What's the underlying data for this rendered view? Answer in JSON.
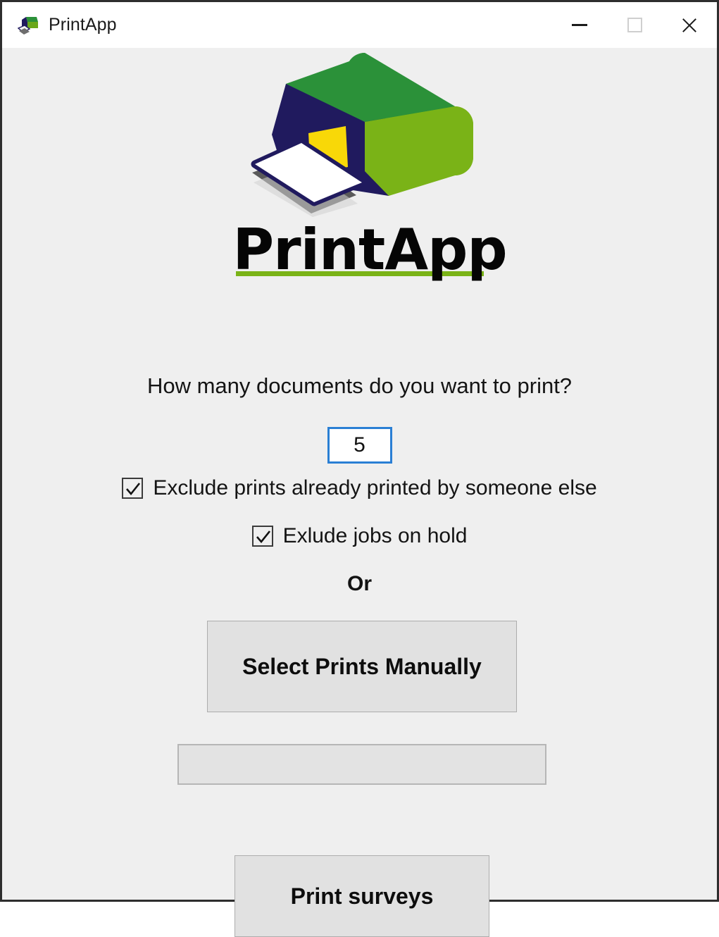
{
  "window": {
    "title": "PrintApp",
    "icon": "printer-app-icon",
    "controls": {
      "minimize": "minimize-icon",
      "maximize": "maximize-icon",
      "close": "close-icon"
    }
  },
  "logo": {
    "mark": "printer-logo",
    "wordmark": "PrintApp",
    "colors": {
      "green_dark": "#2b9139",
      "green_light": "#7ab317",
      "navy": "#201a5e",
      "yellow": "#f8d808",
      "paper": "#ffffff",
      "shadow": "#5a5a5a"
    }
  },
  "form": {
    "prompt": "How many documents do you want to print?",
    "count": {
      "value": "5",
      "placeholder": ""
    },
    "checkboxes": [
      {
        "label": "Exclude prints already printed by someone else",
        "checked": true
      },
      {
        "label": "Exlude jobs on hold",
        "checked": true
      }
    ],
    "separator": "Or",
    "manual_button": "Select Prints Manually",
    "status_field": {
      "value": "",
      "placeholder": ""
    },
    "print_button": "Print surveys"
  },
  "theme": {
    "background": "#efefef",
    "titlebar": "#ffffff",
    "button_face": "#e1e1e1",
    "button_border": "#adadad",
    "focus_border": "#2a7fd4"
  }
}
